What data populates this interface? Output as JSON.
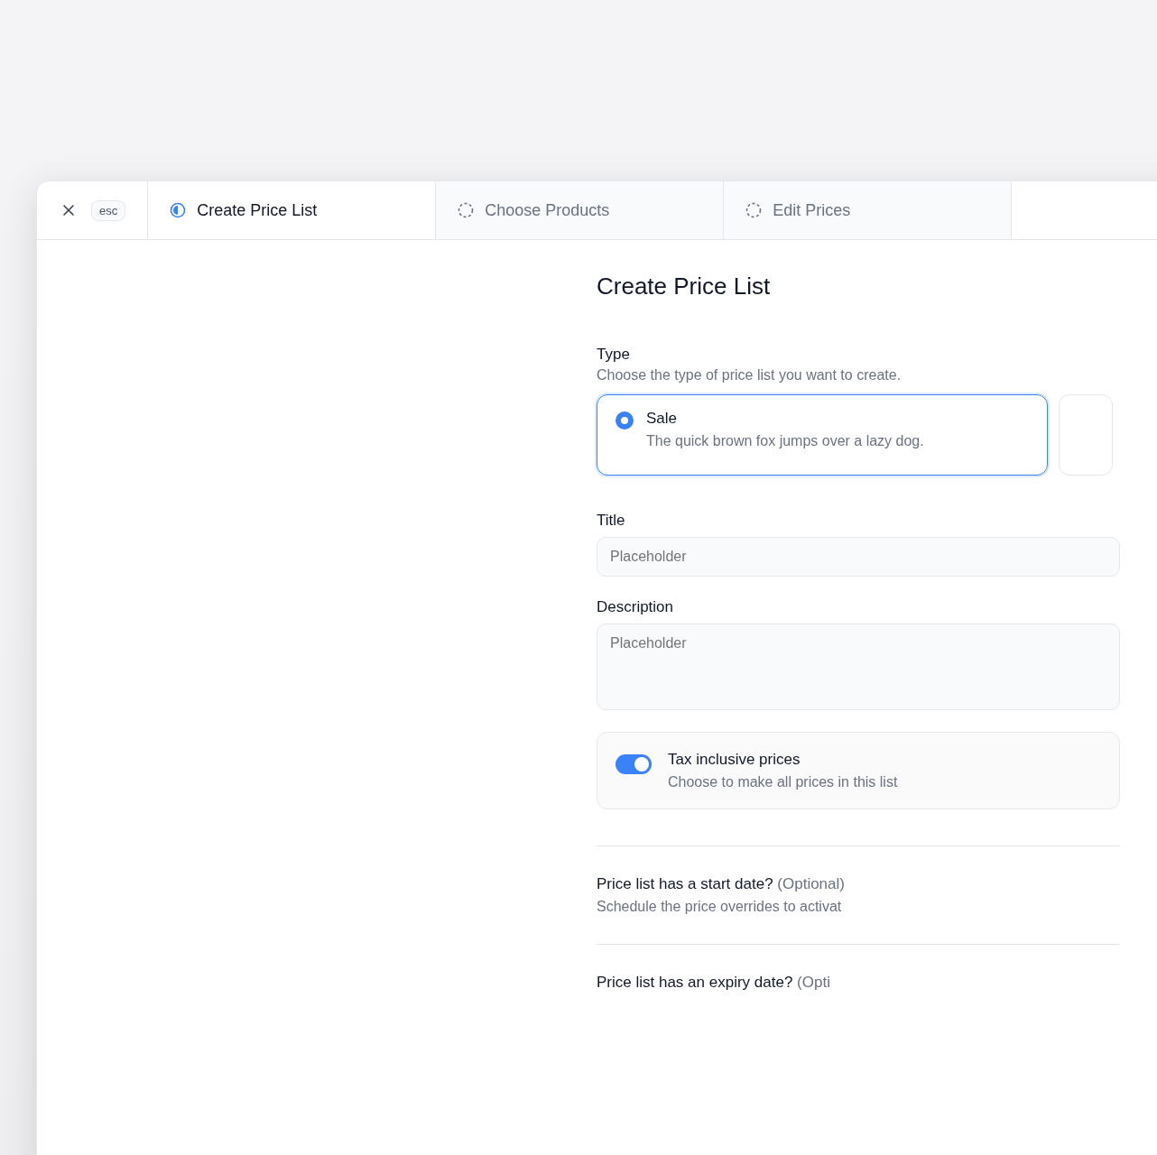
{
  "header": {
    "close_key": "esc",
    "tabs": [
      {
        "label": "Create Price List",
        "kind": "current",
        "selected": true
      },
      {
        "label": "Choose Products",
        "kind": "pending",
        "selected": false
      },
      {
        "label": "Edit Prices",
        "kind": "pending",
        "selected": false
      }
    ]
  },
  "form": {
    "title": "Create Price List",
    "type": {
      "label": "Type",
      "hint": "Choose the type of price list you want to create.",
      "options": [
        {
          "label": "Sale",
          "description": "The quick brown fox jumps over a lazy dog.",
          "selected": true
        }
      ]
    },
    "fields": [
      {
        "label": "Title",
        "placeholder": "Placeholder",
        "kind": "input"
      },
      {
        "label": "Description",
        "placeholder": "Placeholder",
        "kind": "textarea"
      }
    ],
    "tax": {
      "label": "Tax inclusive prices",
      "description": "Choose to make all prices in this list",
      "on": true
    },
    "optional_sections": [
      {
        "label": "Price list has a start date?",
        "tag": "(Optional)",
        "description": "Schedule the price overrides to activat"
      },
      {
        "label": "Price list has an expiry date?",
        "tag": "(Opti"
      }
    ]
  }
}
